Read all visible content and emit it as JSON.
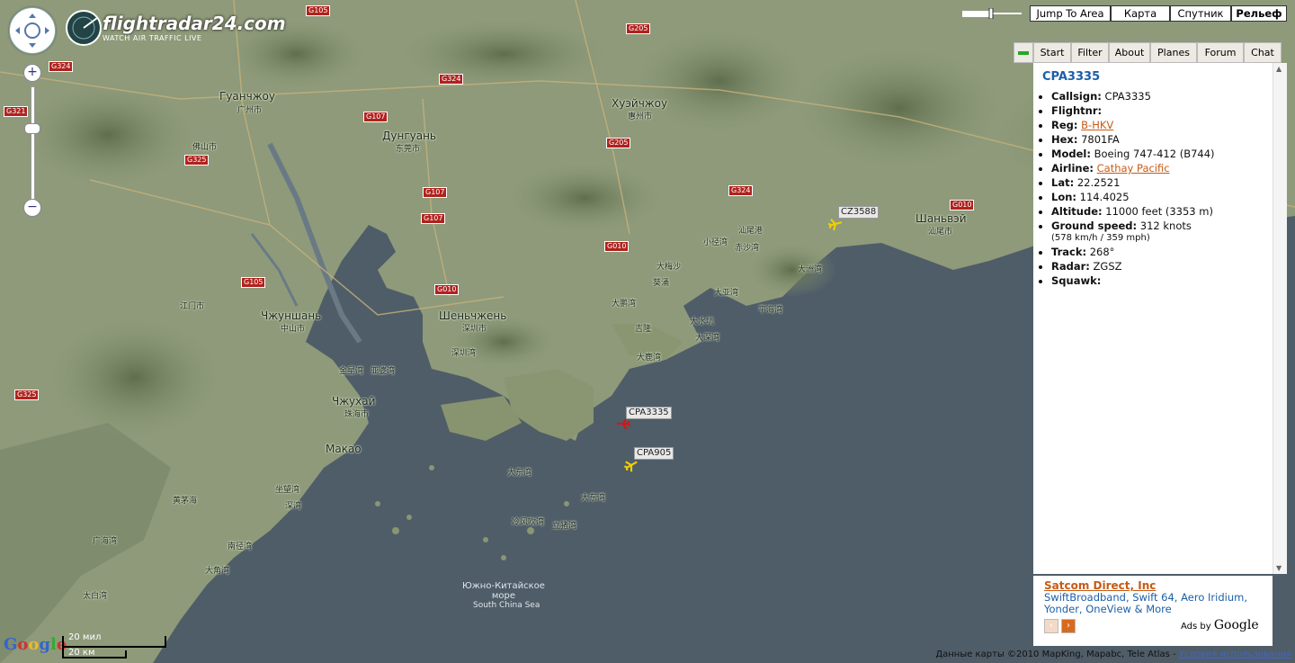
{
  "app": {
    "logo_text": "flightradar24.com",
    "logo_sub": "WATCH AIR TRAFFIC LIVE"
  },
  "map": {
    "cities": [
      {
        "id": "guangzhou",
        "name": "Гуанчжоу",
        "sub": "广州市"
      },
      {
        "id": "dongguan",
        "name": "Дунгуань",
        "sub": "东莞市"
      },
      {
        "id": "huizhou",
        "name": "Хуэйчжоу",
        "sub": "惠州市"
      },
      {
        "id": "shenzhen",
        "name": "Шеньчжень",
        "sub": "深圳市"
      },
      {
        "id": "zhongshan",
        "name": "Чжуншань",
        "sub": "中山市"
      },
      {
        "id": "zhuhai",
        "name": "Чжухай",
        "sub": "珠海市"
      },
      {
        "id": "macao",
        "name": "Макао",
        "sub": ""
      },
      {
        "id": "shanwei",
        "name": "Шаньвэй",
        "sub": "汕尾市"
      }
    ],
    "small_labels": [
      "佛山市",
      "江门市",
      "金星湾",
      "亚婆湾",
      "深圳湾",
      "大鹏湾",
      "葵涌",
      "大梅沙",
      "汕尾港",
      "大洲湾",
      "平海湾",
      "小径湾",
      "赤沙湾",
      "大亚湾",
      "稔平半岛",
      "吉隆",
      "大水坑",
      "大深湾",
      "大鹿湾",
      "大东湾",
      "香港",
      "赤湾",
      "鹿颈湾",
      "长沙湾",
      "平洲",
      "大东湾",
      "坪洲",
      "冷风吹湾",
      "立猪湾",
      "鸡笼湾",
      "黄茅海",
      "广海湾",
      "南径湾",
      "大角湾",
      "太白湾",
      "大洲湾",
      "大襟岛",
      "澳门",
      "坐望湾",
      "深湾"
    ],
    "roads": [
      "G105",
      "G205",
      "G324",
      "G321",
      "G325",
      "G107",
      "G205",
      "G107",
      "G107",
      "G010",
      "G010",
      "G324",
      "G010",
      "G105",
      "G325"
    ],
    "sea_ru": "Южно-Китайское\nморе",
    "sea_en": "South China Sea",
    "footer": "Данные карты ©2010 MapKing, Mapabc, Tele Atlas - ",
    "footer_link": "Условия использования",
    "google": "Google",
    "scale_top": "20 мил",
    "scale_bottom": "20 км"
  },
  "planes": [
    {
      "callsign": "CZ3588",
      "color": "#f0d000",
      "selected": false
    },
    {
      "callsign": "CPA3335",
      "color": "#d01818",
      "selected": true
    },
    {
      "callsign": "CPA905",
      "color": "#f0d000",
      "selected": false
    }
  ],
  "map_types": {
    "jump": "Jump To Area",
    "map": "Карта",
    "satellite": "Спутник",
    "terrain": "Рельеф",
    "active": "terrain"
  },
  "tabs": [
    "Start",
    "Filter",
    "About",
    "Planes",
    "Forum",
    "Chat"
  ],
  "flight": {
    "title": "CPA3335",
    "fields": [
      {
        "k": "Callsign:",
        "v": "CPA3335"
      },
      {
        "k": "Flightnr:",
        "v": ""
      },
      {
        "k": "Reg:",
        "v": "B-HKV",
        "link": true
      },
      {
        "k": "Hex:",
        "v": "7801FA"
      },
      {
        "k": "Model:",
        "v": "Boeing 747-412 (B744)"
      },
      {
        "k": "Airline:",
        "v": "Cathay Pacific",
        "link": true
      },
      {
        "k": "Lat:",
        "v": "22.2521"
      },
      {
        "k": "Lon:",
        "v": "114.4025"
      },
      {
        "k": "Altitude:",
        "v": "11000 feet (3353 m)"
      },
      {
        "k": "Ground speed:",
        "v": "312 knots",
        "sub": "(578 km/h / 359 mph)"
      },
      {
        "k": "Track:",
        "v": "268°"
      },
      {
        "k": "Radar:",
        "v": "ZGSZ"
      },
      {
        "k": "Squawk:",
        "v": ""
      }
    ]
  },
  "ad": {
    "title": "Satcom Direct, Inc",
    "desc": "SwiftBroadband, Swift 64, Aero Iridium, Yonder, OneView & More",
    "ads_by": "Ads by ",
    "google": "Google"
  },
  "colors": {
    "accent": "#1b5fa8",
    "link": "#c85a14",
    "sea": "#4f5d68",
    "land": "#8e9a7a"
  }
}
